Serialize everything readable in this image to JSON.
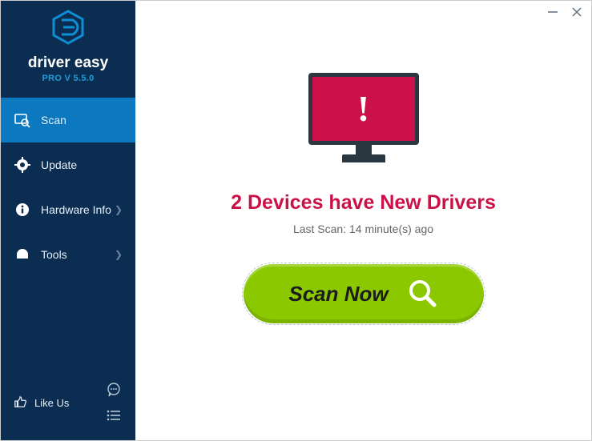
{
  "brand": {
    "name": "driver easy",
    "version_line": "PRO V 5.5.0"
  },
  "sidebar": {
    "items": [
      {
        "label": "Scan",
        "has_chevron": false,
        "active": true
      },
      {
        "label": "Update",
        "has_chevron": false,
        "active": false
      },
      {
        "label": "Hardware Info",
        "has_chevron": true,
        "active": false
      },
      {
        "label": "Tools",
        "has_chevron": true,
        "active": false
      }
    ],
    "like_us": "Like Us"
  },
  "main": {
    "headline": "2 Devices have New Drivers",
    "last_scan": "Last Scan: 14 minute(s) ago",
    "scan_button": "Scan Now"
  }
}
